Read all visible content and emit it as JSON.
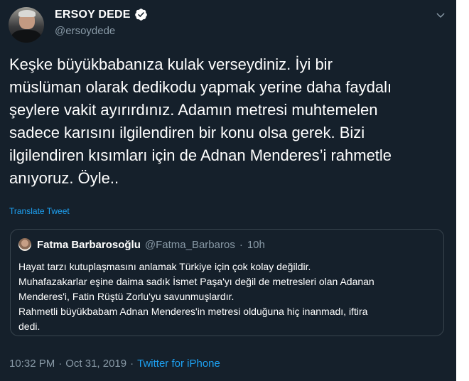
{
  "author": {
    "display_name": "ERSOY DEDE",
    "handle": "@ersoydede"
  },
  "tweet": {
    "lines": [
      "Keşke büyükbabanıza kulak verseydiniz. İyi bir",
      "müslüman olarak dedikodu yapmak yerine daha faydalı",
      "şeylere vakit ayırırdınız. Adamın metresi muhtemelen",
      "sadece karısını ilgilendiren bir konu olsa gerek. Bizi",
      "ilgilendiren kısımları için de Adnan Menderes’i rahmetle",
      "anıyoruz. Öyle.."
    ],
    "translate_label": "Translate Tweet"
  },
  "quoted": {
    "name": "Fatma Barbarosoğlu",
    "handle": "@Fatma_Barbaros",
    "separator": "·",
    "time": "10h",
    "lines": [
      "Hayat tarzı kutuplaşmasını anlamak Türkiye için çok kolay değildir.",
      "Muhafazakarlar  eşine daima sadık İsmet Paşa'yı değil de metresleri olan Adanan",
      "Menderes'i, Fatin Rüştü Zorlu'yu savunmuşlardır.",
      "Rahmetli büyükbabam Adnan Menderes'in metresi olduğuna hiç inanmadı, iftira",
      "dedi."
    ]
  },
  "footer": {
    "time": "10:32 PM",
    "separator1": "·",
    "date": "Oct 31, 2019",
    "separator2": "·",
    "source": "Twitter for iPhone"
  },
  "icons": {
    "verified": "verified-badge-icon",
    "caret": "chevron-down-icon"
  },
  "colors": {
    "background": "#15202b",
    "link": "#1da1f2",
    "secondary_text": "#8899a6",
    "border": "#38444d"
  }
}
